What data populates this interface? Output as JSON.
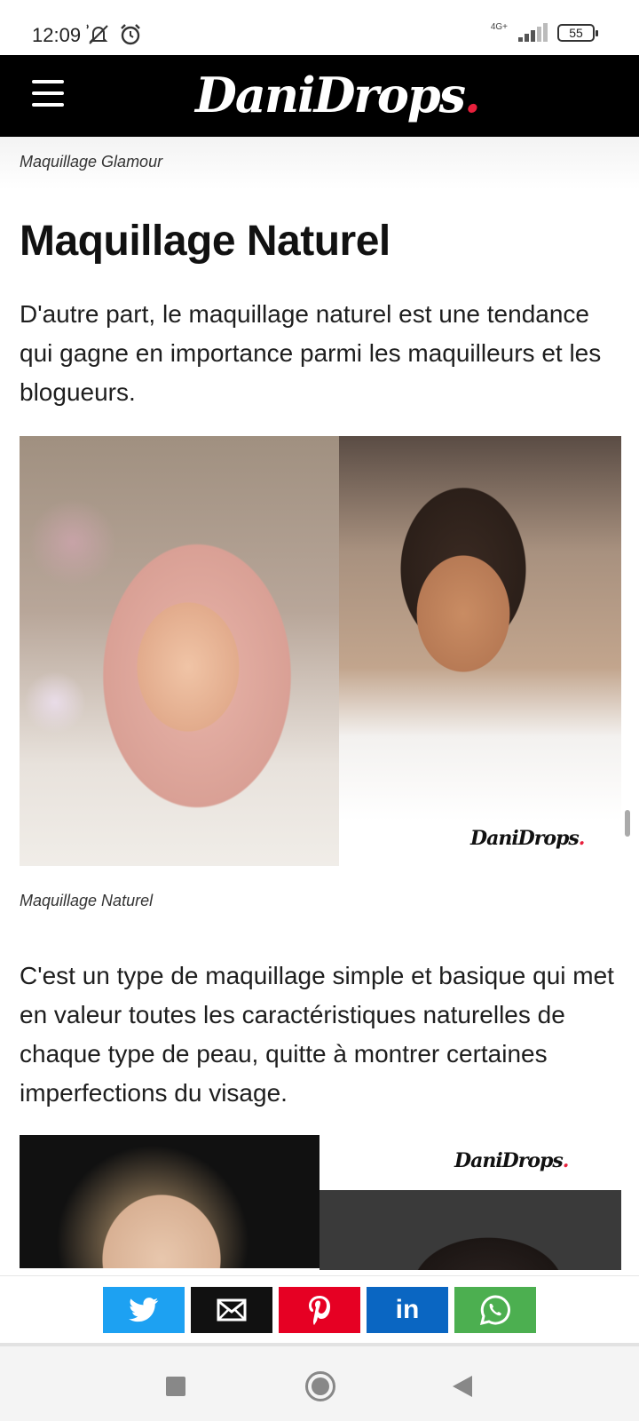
{
  "status_bar": {
    "time": "12:09",
    "network": "4G+",
    "battery": "55"
  },
  "header": {
    "brand_name": "DaniDrops",
    "brand_dot": ".",
    "brand_color": "#000000",
    "accent_color": "#e8203c"
  },
  "article": {
    "caption_top": "Maquillage Glamour",
    "heading": "Maquillage Naturel",
    "paragraph_1": "D'autre part, le maquillage naturel est une tendance qui gagne en importance parmi les maquilleurs et les blogueurs.",
    "image_1_logo": "DaniDrops",
    "image_1_logo_dot": ".",
    "caption_image_1": "Maquillage Naturel",
    "paragraph_2": "C'est un type de maquillage simple et basique qui met en valeur toutes les caractéristiques naturelles de chaque type de peau, quitte à montrer certaines imperfections du visage.",
    "image_2_logo": "DaniDrops",
    "image_2_logo_dot": "."
  },
  "share_bar": {
    "buttons": [
      {
        "name": "twitter",
        "icon": "twitter-icon",
        "color": "#1da1f2"
      },
      {
        "name": "email",
        "icon": "envelope-icon",
        "color": "#111111"
      },
      {
        "name": "pinterest",
        "icon": "pinterest-icon",
        "color": "#e60023"
      },
      {
        "name": "linkedin",
        "icon": "linkedin-icon",
        "label": "in",
        "color": "#0a66c2"
      },
      {
        "name": "whatsapp",
        "icon": "whatsapp-icon",
        "color": "#4caf50"
      }
    ]
  },
  "nav_bar": {
    "icons": [
      "recents-square-icon",
      "home-circle-icon",
      "back-triangle-icon"
    ]
  }
}
